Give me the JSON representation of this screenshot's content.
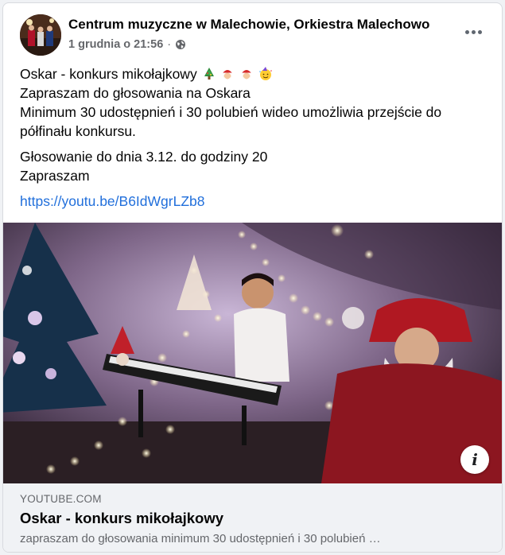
{
  "post": {
    "page_name": "Centrum muzyczne w Malechowie, Orkiestra Malechowo",
    "timestamp": "1 grudnia o 21:56",
    "separator": "·",
    "text_lines": [
      "Oskar - konkurs mikołajkowy",
      "Zapraszam do głosowania na Oskara",
      "Minimum 30 udostępnień i 30 polubień wideo umożliwia przejście do półfinału konkursu."
    ],
    "emojis": [
      "christmas-tree-icon",
      "santa-face-icon",
      "santa-face-icon",
      "party-face-icon"
    ],
    "voting_line": "Głosowanie do dnia 3.12. do godziny 20",
    "closing_line": "Zapraszam",
    "link": "https://youtu.be/B6IdWgrLZb8"
  },
  "link_preview": {
    "domain": "YOUTUBE.COM",
    "title": "Oskar - konkurs mikołajkowy",
    "description": "zapraszam do głosowania minimum 30 udostępnień i 30 polubień …"
  },
  "media": {
    "info_label": "i"
  },
  "colors": {
    "link": "#216fdb",
    "secondary_text": "#65676b",
    "card_bg": "#ffffff",
    "preview_bg": "#f0f2f5"
  }
}
